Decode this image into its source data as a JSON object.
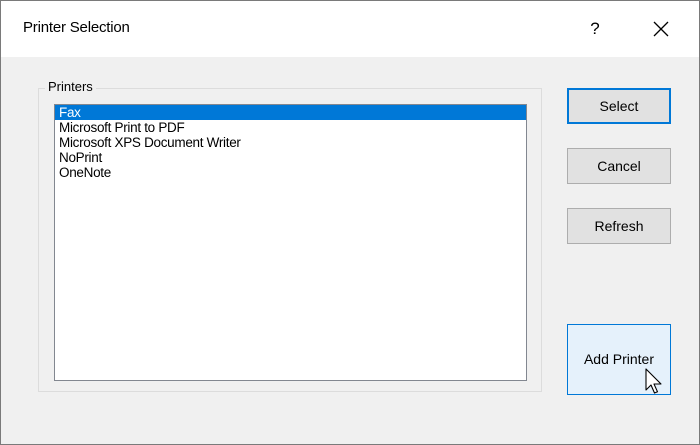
{
  "window": {
    "title": "Printer Selection",
    "help_glyph": "?",
    "close_icon": "close-icon"
  },
  "printers_group": {
    "label": "Printers",
    "items": [
      {
        "name": "Fax",
        "selected": true
      },
      {
        "name": "Microsoft Print to PDF",
        "selected": false
      },
      {
        "name": "Microsoft XPS Document Writer",
        "selected": false
      },
      {
        "name": "NoPrint",
        "selected": false
      },
      {
        "name": "OneNote",
        "selected": false
      }
    ]
  },
  "buttons": {
    "select": "Select",
    "cancel": "Cancel",
    "refresh": "Refresh",
    "add_printer": "Add Printer"
  },
  "colors": {
    "selection": "#0078d7",
    "button_face": "#e1e1e1",
    "hover_face": "#e5f1fb"
  }
}
